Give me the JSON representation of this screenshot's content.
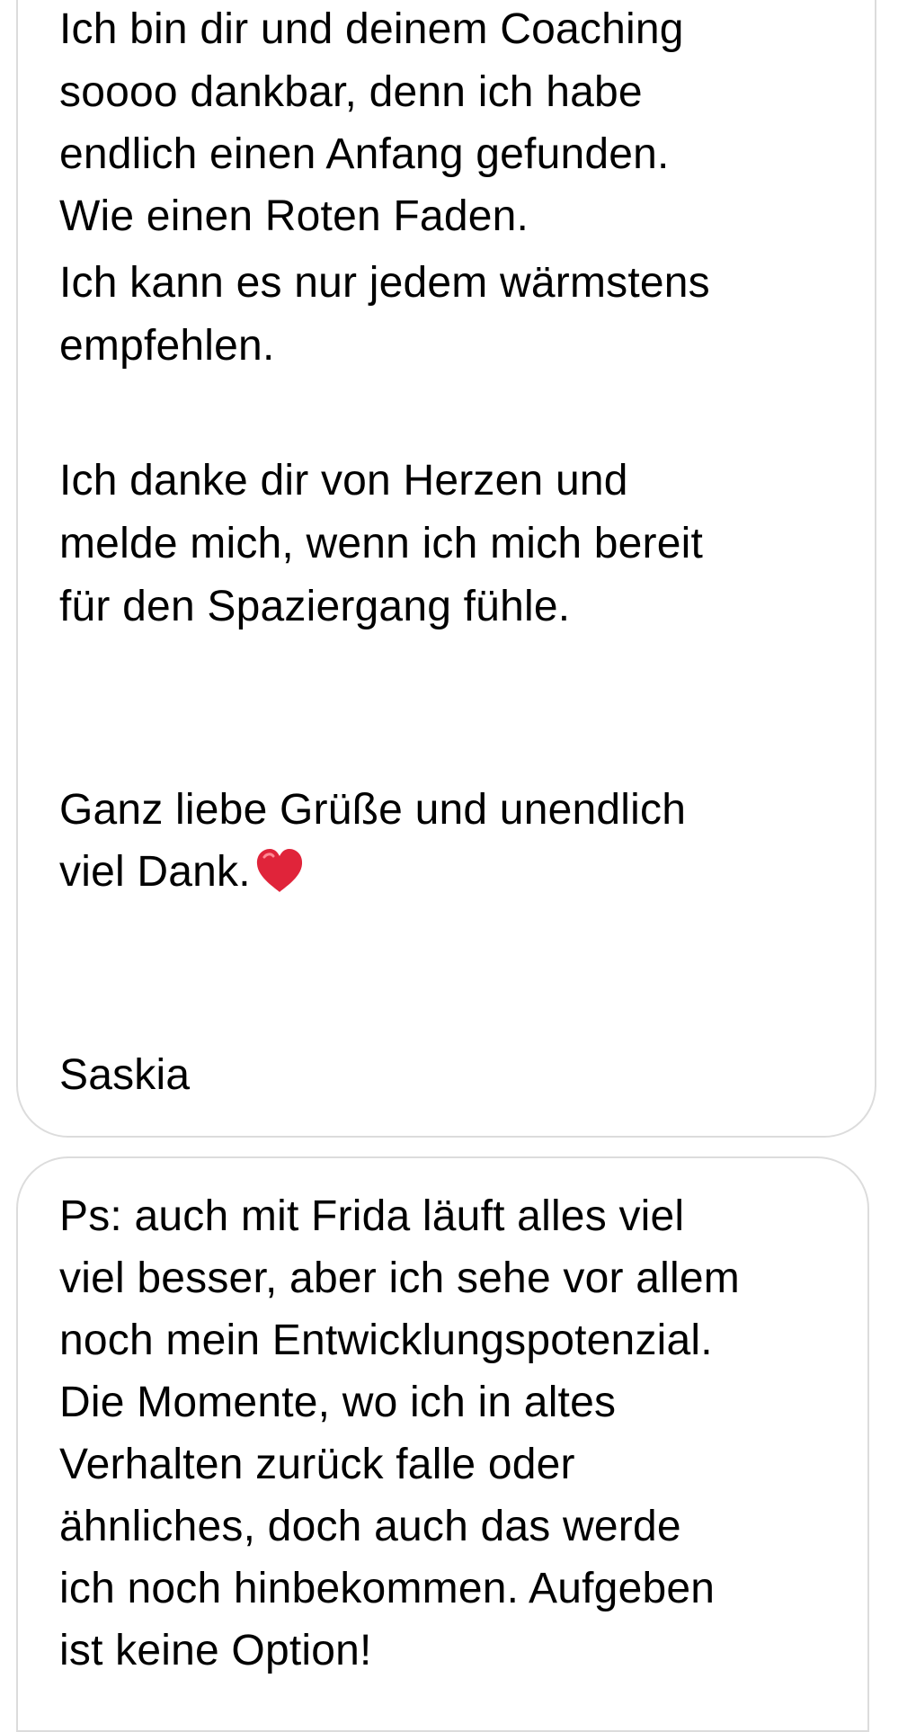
{
  "message_1": {
    "paragraph_1": [
      "Ich bin dir und deinem Coaching",
      "soooo dankbar, denn ich habe",
      "endlich einen Anfang gefunden.",
      "Wie einen Roten Faden."
    ],
    "paragraph_2": [
      "Ich kann es nur jedem wärmstens",
      "empfehlen."
    ],
    "paragraph_3": [
      "Ich danke dir von Herzen und",
      "melde mich, wenn ich mich bereit",
      "für den Spaziergang fühle."
    ],
    "paragraph_4": [
      "Ganz liebe Grüße und unendlich",
      "viel Dank."
    ],
    "emoji_icon": "red-heart-icon",
    "emoji_color": "#e0243a",
    "signature": "Saskia"
  },
  "message_2": {
    "lines": [
      "Ps: auch mit Frida läuft alles viel",
      "viel besser, aber ich sehe vor allem",
      "noch mein Entwicklungspotenzial.",
      "Die Momente, wo ich in altes",
      "Verhalten zurück falle oder",
      "ähnliches, doch auch das werde",
      "ich noch hinbekommen.  Aufgeben",
      "ist keine Option!"
    ]
  },
  "colors": {
    "bubble_border": "#dcdcdc",
    "text": "#000000",
    "background": "#ffffff"
  }
}
